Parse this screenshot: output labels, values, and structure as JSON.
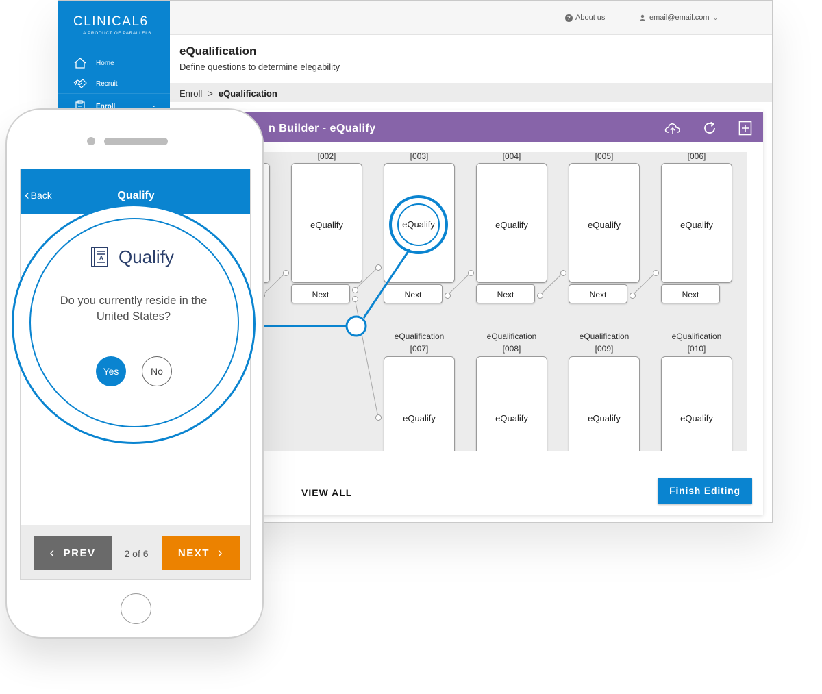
{
  "brand": {
    "name": "CLINICAL6",
    "tagline": "A PRODUCT OF PARALLEL6"
  },
  "sidebar": {
    "items": [
      {
        "label": "Home",
        "icon": "home-icon"
      },
      {
        "label": "Recruit",
        "icon": "handshake-icon"
      },
      {
        "label": "Enroll",
        "icon": "clipboard-icon"
      }
    ]
  },
  "topbar": {
    "about_label": "About us",
    "account_label": "email@email.com"
  },
  "page": {
    "title": "eQualification",
    "subtitle": "Define questions to determine elegability"
  },
  "breadcrumb": {
    "parent": "Enroll",
    "separator": ">",
    "current": "eQualification"
  },
  "builder": {
    "title": "n Builder - eQualify",
    "cards_top": [
      {
        "id": "[002]",
        "label": "eQualify",
        "next": "Next"
      },
      {
        "id": "[003]",
        "label": "eQualify",
        "next": "Next"
      },
      {
        "id": "[004]",
        "label": "eQualify",
        "next": "Next"
      },
      {
        "id": "[005]",
        "label": "eQualify",
        "next": "Next"
      },
      {
        "id": "[006]",
        "label": "eQualify",
        "next": "Next"
      }
    ],
    "cards_bottom": [
      {
        "name": "eQualification",
        "id": "[007]",
        "label": "eQualify"
      },
      {
        "name": "eQualification",
        "id": "[008]",
        "label": "eQualify"
      },
      {
        "name": "eQualification",
        "id": "[009]",
        "label": "eQualify"
      },
      {
        "name": "eQualification",
        "id": "[010]",
        "label": "eQualify"
      }
    ],
    "view_all_label": "VIEW ALL",
    "finish_label": "Finish Editing",
    "zoom_label": "eQualify"
  },
  "phone": {
    "back_label": "Back",
    "header_title": "Qualify",
    "brand_label": "Qualify",
    "question": "Do you currently reside in the United States?",
    "yes_label": "Yes",
    "no_label": "No",
    "prev_label": "PREV",
    "page_count": "2 of 6",
    "next_label": "NEXT"
  },
  "colors": {
    "primary_blue": "#0a84d0",
    "purple": "#8764a9",
    "orange": "#ec8200",
    "gray_button": "#6a6a6a"
  }
}
